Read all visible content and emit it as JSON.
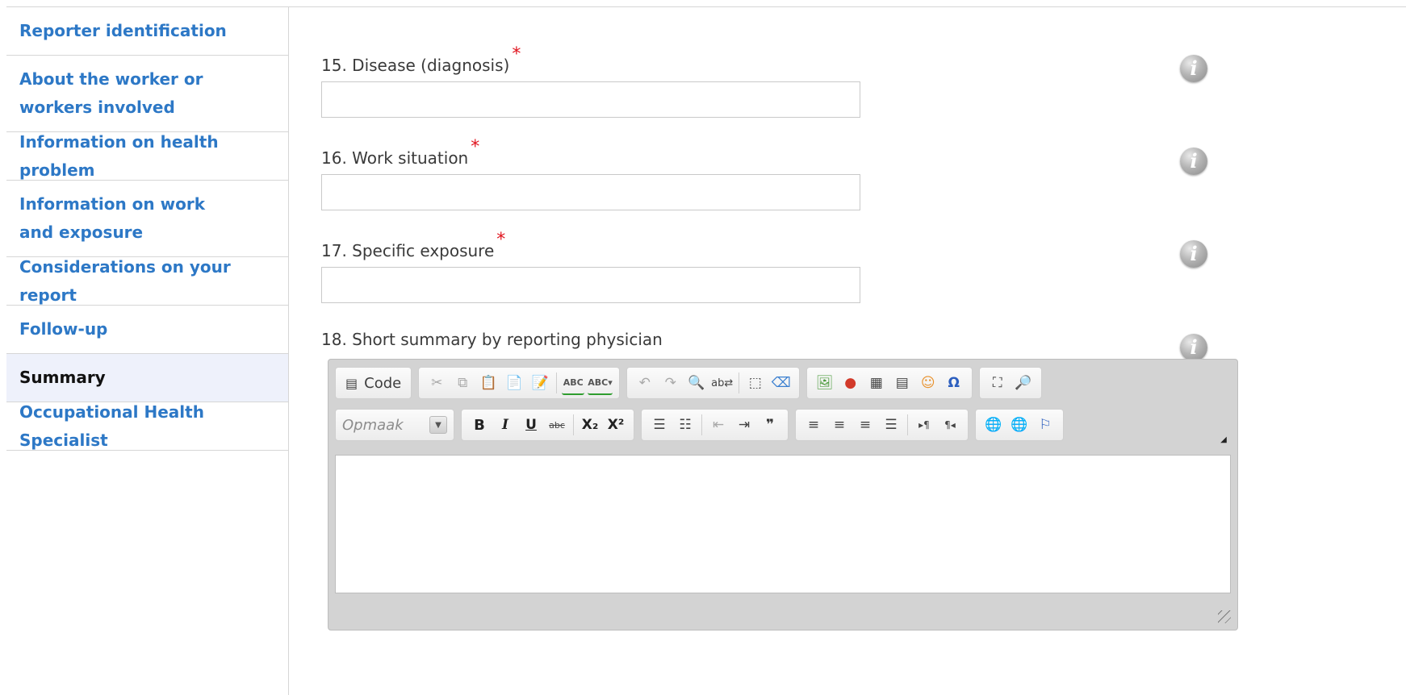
{
  "sidebar": {
    "items": [
      {
        "label": "Reporter identification"
      },
      {
        "label": "About the worker or workers involved"
      },
      {
        "label": "Information on health problem"
      },
      {
        "label": "Information on work and exposure"
      },
      {
        "label": "Considerations on your report"
      },
      {
        "label": "Follow-up"
      },
      {
        "label": "Summary",
        "active": true
      },
      {
        "label": "Occupational Health Specialist"
      }
    ]
  },
  "form": {
    "fields": [
      {
        "label": "15. Disease (diagnosis)",
        "required_mark": "*",
        "value": "",
        "placeholder": ""
      },
      {
        "label": "16. Work situation",
        "required_mark": "*",
        "value": "",
        "placeholder": ""
      },
      {
        "label": "17. Specific exposure",
        "required_mark": "*",
        "value": "",
        "placeholder": ""
      }
    ],
    "summary_label": "18. Short summary by reporting physician"
  },
  "icons": {
    "info": "i"
  },
  "editor": {
    "source_button_label": "Code",
    "format_combo_label": "Opmaak",
    "bold": "B",
    "italic": "I",
    "underline": "U",
    "strike": "abc",
    "subscript": "X₂",
    "superscript": "X²",
    "blockquote": "❞",
    "spellcheck": "ABC",
    "spellcheck_as_you_type": "ABC▾",
    "omega": "Ω",
    "content": ""
  },
  "colors": {
    "link": "#2d78c6",
    "active_bg": "#eef1fb",
    "required": "#e0141e"
  }
}
